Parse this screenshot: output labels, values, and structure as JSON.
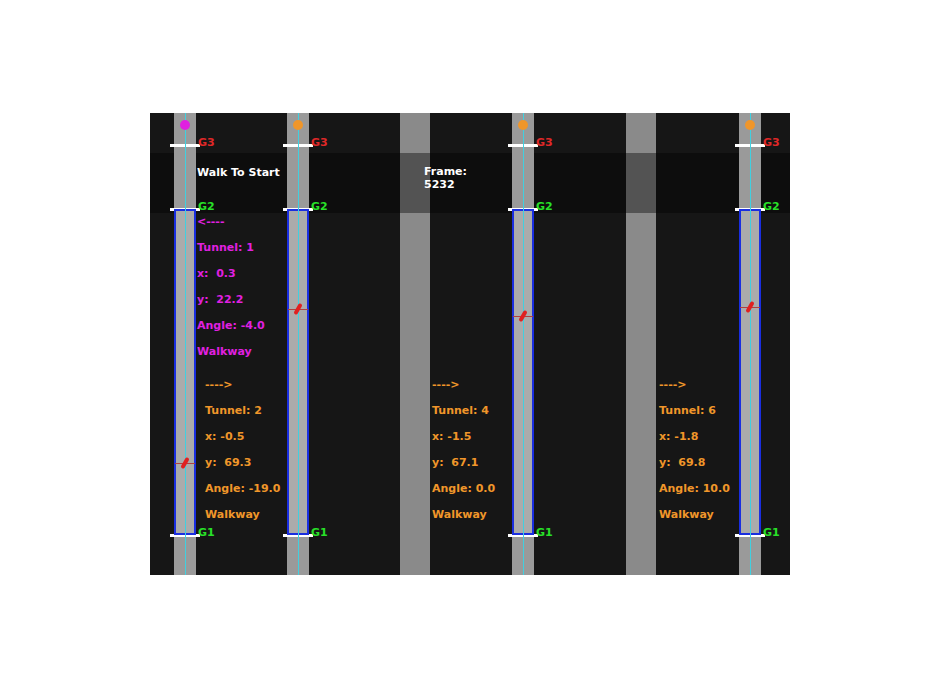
{
  "status": "Walk To Start",
  "frame": {
    "label": "Frame:",
    "value": "5232"
  },
  "gates": [
    {
      "label": "G3",
      "color": "#e02828"
    },
    {
      "label": "G2",
      "color": "#28e028"
    },
    {
      "label": "G1",
      "color": "#28e028"
    }
  ],
  "tunnels": [
    {
      "arrow": "<----",
      "tunnel": "Tunnel: 1",
      "x": "x:  0.3",
      "y": "y:  22.2",
      "angle": "Angle: -4.0",
      "zone": "Walkway",
      "color": "#e020e0",
      "level": 0.222
    },
    {
      "arrow": "---->",
      "tunnel": "Tunnel: 2",
      "x": "x: -0.5",
      "y": "y:  69.3",
      "angle": "Angle: -19.0",
      "zone": "Walkway",
      "color": "#f0962a",
      "level": 0.693
    },
    {
      "arrow": "---->",
      "tunnel": "Tunnel: 4",
      "x": "x: -1.5",
      "y": "y:  67.1",
      "angle": "Angle: 0.0",
      "zone": "Walkway",
      "color": "#f0962a",
      "level": 0.671
    },
    {
      "arrow": "---->",
      "tunnel": "Tunnel: 6",
      "x": "x: -1.8",
      "y": "y:  69.8",
      "angle": "Angle: 10.0",
      "zone": "Walkway",
      "color": "#f0962a",
      "level": 0.698
    }
  ]
}
